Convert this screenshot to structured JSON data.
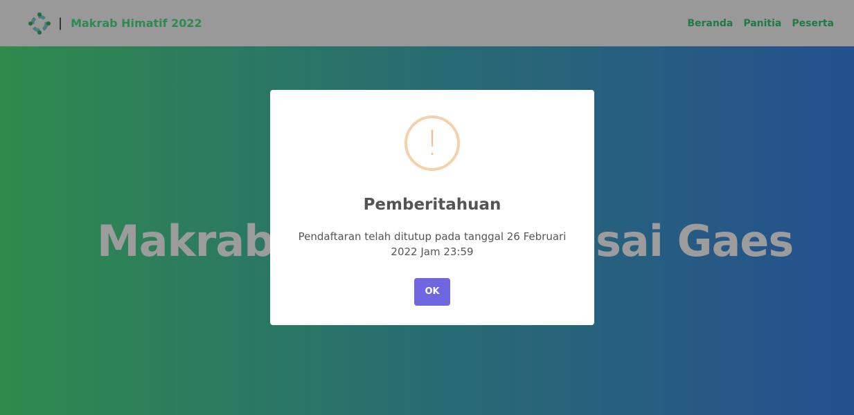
{
  "navbar": {
    "brand": "Makrab Himatif 2022",
    "separator": "|",
    "links": [
      "Beranda",
      "Panitia",
      "Peserta"
    ]
  },
  "hero": {
    "title_left_visible": "Makrab",
    "title_right_visible": "sai Gaes"
  },
  "modal": {
    "icon": "warning-icon",
    "title": "Pemberitahuan",
    "message": "Pendaftaran telah ditutup pada tanggal 26 Februari 2022 Jam 23:59",
    "ok_label": "OK",
    "accent": "#7066e0"
  }
}
